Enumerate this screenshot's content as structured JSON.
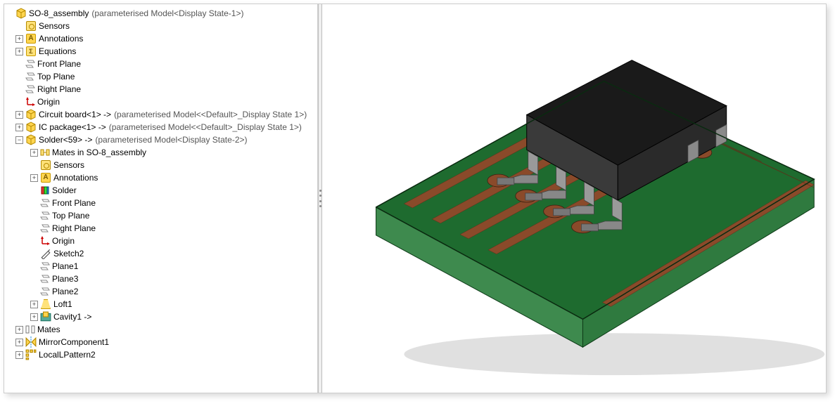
{
  "root": {
    "label": "SO-8_assembly",
    "suffix": "(parameterised Model<Display State-1>)"
  },
  "tree": {
    "sensors": "Sensors",
    "annotations": "Annotations",
    "equations": "Equations",
    "front_plane": "Front Plane",
    "top_plane": "Top Plane",
    "right_plane": "Right Plane",
    "origin": "Origin",
    "circuit_board": {
      "label": "Circuit board<1> ->",
      "suffix": "(parameterised Model<<Default>_Display State 1>)"
    },
    "ic_package": {
      "label": "IC package<1> ->",
      "suffix": "(parameterised Model<<Default>_Display State 1>)"
    },
    "solder": {
      "label": "Solder<59> ->",
      "suffix": "(parameterised Model<Display State-2>)"
    },
    "solder_children": {
      "mates_in": "Mates in SO-8_assembly",
      "sensors": "Sensors",
      "annotations": "Annotations",
      "solder_mat": "Solder",
      "front_plane": "Front Plane",
      "top_plane": "Top Plane",
      "right_plane": "Right Plane",
      "origin": "Origin",
      "sketch2": "Sketch2",
      "plane1": "Plane1",
      "plane3": "Plane3",
      "plane2": "Plane2",
      "loft1": "Loft1",
      "cavity1": "Cavity1 ->"
    },
    "mates": "Mates",
    "mirror1": "MirrorComponent1",
    "pattern2": "LocalLPattern2"
  },
  "icons": {
    "assembly": "assembly-icon",
    "sensor": "sensor-icon",
    "annotation": "annotation-icon",
    "equation": "equation-icon",
    "plane": "plane-icon",
    "origin": "origin-icon",
    "part": "part-icon",
    "mates": "mates-icon",
    "sketch": "sketch-icon",
    "solder": "solder-material-icon",
    "loft": "loft-icon",
    "cavity": "cavity-icon",
    "mirror": "mirror-icon",
    "pattern": "pattern-icon"
  },
  "colors": {
    "pcb_top": "#1e6b2f",
    "pcb_side": "#3e8a4e",
    "pcb_front": "#2f7a3f",
    "copper": "#8a4a2a",
    "chip_top": "#1a1a1a",
    "chip_side": "#555",
    "lead": "#888"
  }
}
